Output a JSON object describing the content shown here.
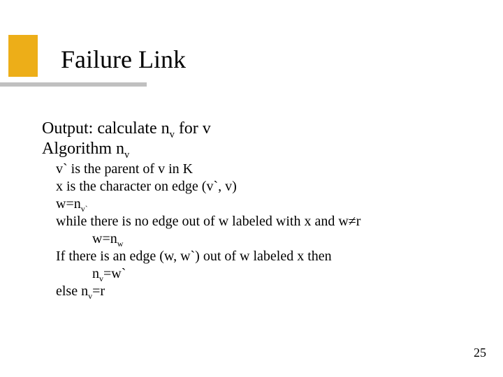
{
  "title": "Failure Link",
  "output_line": {
    "prefix": "Output: calculate n",
    "sub1": "v",
    "suffix": " for v"
  },
  "algo_line": {
    "prefix": "Algorithm n",
    "sub1": "v"
  },
  "steps": {
    "s1": "v` is the parent of v in K",
    "s2": "x is the character on edge (v`, v)",
    "s3": {
      "a": "w=n",
      "sub": "v`"
    },
    "s4": "while there is no edge out of w labeled with x and w≠r",
    "s5": {
      "a": "w=n",
      "sub": "w"
    },
    "s6": "If there is an edge (w, w`) out of w labeled x then",
    "s7": {
      "a": "n",
      "sub": "v",
      "b": "=w`"
    },
    "s8": {
      "a": "else n",
      "sub": "v",
      "b": "=r"
    }
  },
  "page_number": "25"
}
